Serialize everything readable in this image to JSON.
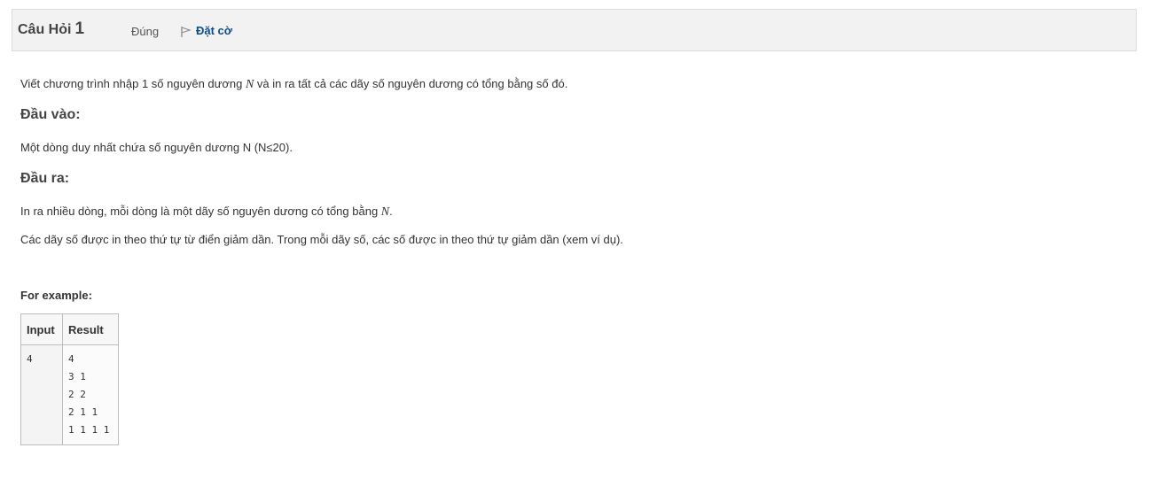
{
  "question": {
    "label": "Câu Hỏi",
    "number": "1",
    "state": "Đúng",
    "flag_label": "Đặt cờ",
    "flag_icon": "flag-outline-icon",
    "flag_color": "#0f4d8a"
  },
  "content": {
    "intro_before": "Viết chương trình nhập 1 số nguyên dương ",
    "intro_var": "N",
    "intro_after": " và in ra tất cả các dãy số nguyên dương có tổng bằng số đó.",
    "input_heading": "Đầu vào:",
    "input_desc": "Một dòng duy nhất chứa số nguyên dương N (N≤20).",
    "output_heading": "Đầu ra:",
    "output_desc_before": "In ra nhiều dòng, mỗi dòng là một dãy số nguyên dương có tổng bằng ",
    "output_desc_var": "N",
    "output_desc_after": ".",
    "order_desc": "Các dãy số được in theo thứ tự từ điển giảm dần. Trong mỗi dãy số, các số được in theo thứ tự giảm dần (xem ví dụ).",
    "for_example": "For example:"
  },
  "examples": {
    "headers": [
      "Input",
      "Result"
    ],
    "rows": [
      {
        "input": "4",
        "result": "4\n3 1\n2 2\n2 1 1\n1 1 1 1"
      }
    ]
  }
}
